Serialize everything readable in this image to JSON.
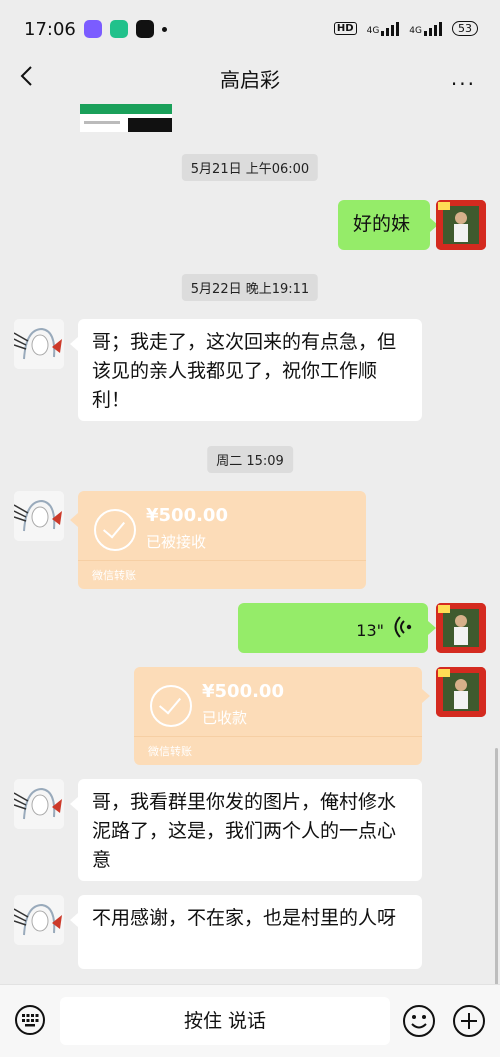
{
  "status_bar": {
    "time": "17:06",
    "hd": "HD",
    "net1": "4G",
    "net2": "4G",
    "battery": "53"
  },
  "header": {
    "title": "高启彩",
    "more": "···"
  },
  "messages": {
    "ts1": "5月21日 上午06:00",
    "m1_text": "好的妹",
    "ts2": "5月22日 晚上19:11",
    "m2_text": "哥；我走了，这次回来的有点急，但该见的亲人我都见了，祝你工作顺利！",
    "ts3": "周二 15:09",
    "t1_amount": "¥500.00",
    "t1_status": "已被接收",
    "t1_footer": "微信转账",
    "voice_duration": "13\"",
    "t2_amount": "¥500.00",
    "t2_status": "已收款",
    "t2_footer": "微信转账",
    "m3_text": "哥，我看群里你发的图片，俺村修水泥路了，这是，我们两个人的一点心意",
    "m4_text": "不用感谢，不在家，也是村里的人呀"
  },
  "input_bar": {
    "hold_to_talk": "按住 说话"
  },
  "colors": {
    "chat_bg": "#ededed",
    "bubble_green": "#95ec69",
    "bubble_white": "#ffffff",
    "transfer_orange": "#fcdcb8",
    "timestamp_bg": "#dcdcdc"
  }
}
